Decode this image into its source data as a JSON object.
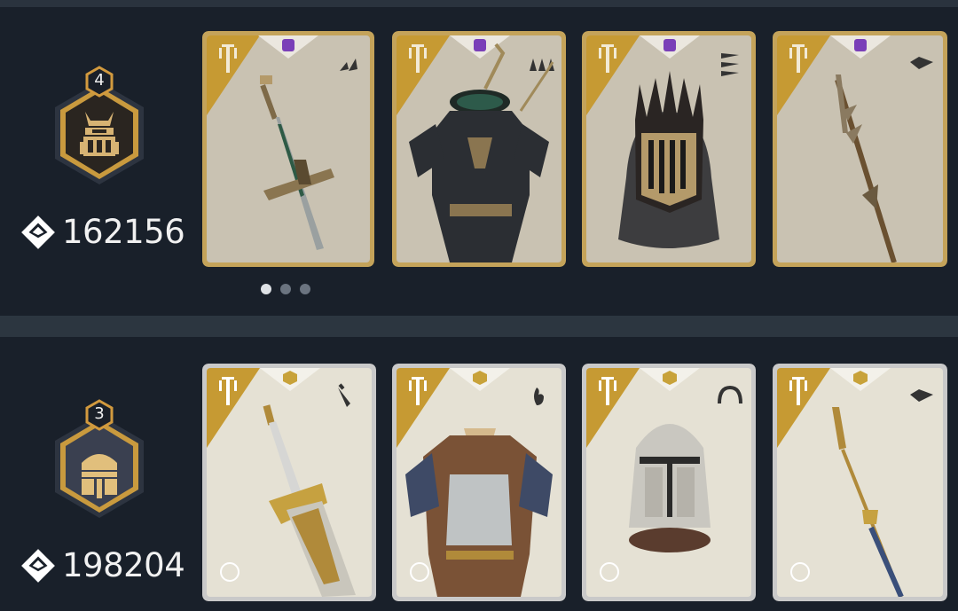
{
  "rows": [
    {
      "rank_number": "4",
      "score": "162156",
      "badge_frame_color": "#c99a3e",
      "badge_fill_color": "#2a2520",
      "rarity": "epic",
      "rarity_color": "#7a3fb8",
      "card_tint": "#c9c2b2",
      "cards": [
        {
          "item": "dark-greatsword",
          "category_icon": "sword-pair-icon"
        },
        {
          "item": "dark-armor",
          "category_icon": "triple-spike-icon"
        },
        {
          "item": "dark-crowned-helmet",
          "category_icon": "arrows-icon"
        },
        {
          "item": "dark-spear",
          "category_icon": "spear-head-icon"
        }
      ],
      "pagination": {
        "pages": 3,
        "active": 0
      }
    },
    {
      "rank_number": "3",
      "score": "198204",
      "badge_frame_color": "#c99a3e",
      "badge_fill_color": "#3a4050",
      "rarity": "legendary",
      "rarity_color": "#c8a23a",
      "card_tint": "#e5e1d4",
      "cards": [
        {
          "item": "golden-greatsword",
          "category_icon": "blade-icon"
        },
        {
          "item": "leather-plate-armor",
          "category_icon": "flame-icon"
        },
        {
          "item": "knight-great-helm",
          "category_icon": "arc-icon"
        },
        {
          "item": "golden-spear",
          "category_icon": "spear-head-icon"
        }
      ]
    }
  ]
}
